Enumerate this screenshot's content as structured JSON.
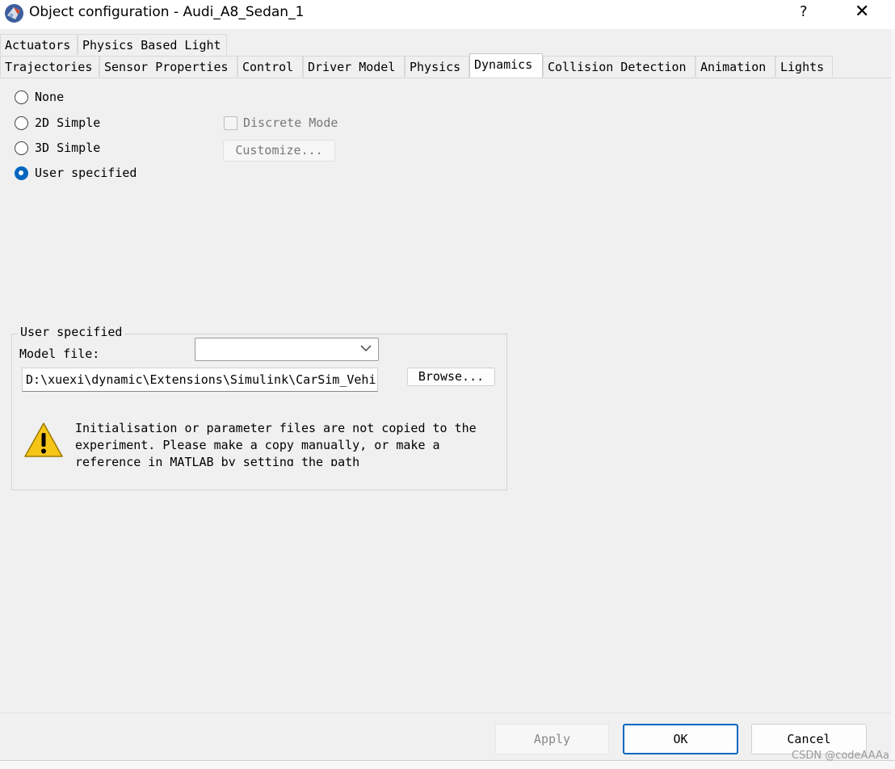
{
  "window": {
    "title": "Object configuration - Audi_A8_Sedan_1",
    "help_label": "?",
    "close_label": "✕"
  },
  "tabs": {
    "row1": [
      "Actuators",
      "Physics Based Light"
    ],
    "row2": [
      "Trajectories",
      "Sensor Properties",
      "Control",
      "Driver Model",
      "Physics",
      "Dynamics",
      "Collision Detection",
      "Animation",
      "Lights"
    ],
    "active": "Dynamics"
  },
  "dynamics": {
    "options": [
      {
        "label": "None",
        "checked": false
      },
      {
        "label": "2D Simple",
        "checked": false
      },
      {
        "label": "3D Simple",
        "checked": false
      },
      {
        "label": "User specified",
        "checked": true
      }
    ],
    "discrete_mode_label": "Discrete Mode",
    "customize_label": "Customize..."
  },
  "user_specified": {
    "group_title": "User specified",
    "model_file_label": "Model file:",
    "model_file_selected": "",
    "path_value": "D:\\xuexi\\dynamic\\Extensions\\Simulink\\CarSim_Vehi",
    "browse_label": "Browse...",
    "warning_text": "Initialisation or parameter files are not copied to the experiment. Please make a copy manually, or make a reference in MATLAB by setting the path"
  },
  "footer": {
    "apply_label": "Apply",
    "ok_label": "OK",
    "cancel_label": "Cancel"
  },
  "watermark": "CSDN @codeAAAa",
  "colors": {
    "accent": "#0067c0",
    "dialog_bg": "#f0f0f0",
    "warning_yellow": "#f5c518"
  }
}
